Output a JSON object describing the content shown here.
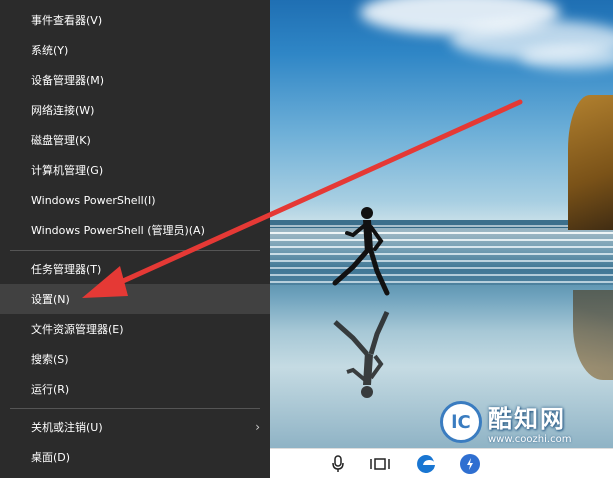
{
  "menu": {
    "items": [
      {
        "label": "事件查看器(V)"
      },
      {
        "label": "系统(Y)"
      },
      {
        "label": "设备管理器(M)"
      },
      {
        "label": "网络连接(W)"
      },
      {
        "label": "磁盘管理(K)"
      },
      {
        "label": "计算机管理(G)"
      },
      {
        "label": "Windows PowerShell(I)"
      },
      {
        "label": "Windows PowerShell (管理员)(A)"
      },
      {
        "label": "任务管理器(T)"
      },
      {
        "label": "设置(N)"
      },
      {
        "label": "文件资源管理器(E)"
      },
      {
        "label": "搜索(S)"
      },
      {
        "label": "运行(R)"
      },
      {
        "label": "关机或注销(U)"
      },
      {
        "label": "桌面(D)"
      }
    ],
    "active_item": "设置(N)",
    "submenu_arrow": "›"
  },
  "watermark": {
    "title": "酷知网",
    "url": "www.coozhi.com",
    "logo_glyph": "lC"
  },
  "taskbar": {
    "icons": [
      "microphone-icon",
      "task-view-icon",
      "edge-browser-icon",
      "app-icon"
    ]
  },
  "colors": {
    "menu_bg": "#2b2b2b",
    "menu_active": "#414141",
    "arrow": "#e53935"
  }
}
